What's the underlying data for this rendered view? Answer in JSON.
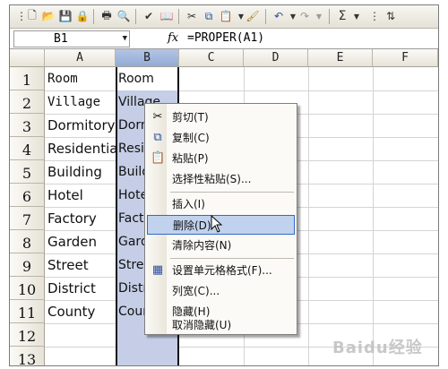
{
  "formula_bar": {
    "name_box": "B1",
    "fx": "fx",
    "formula": "=PROPER(A1)"
  },
  "columns": [
    "A",
    "B",
    "C",
    "D",
    "E",
    "F"
  ],
  "rows": [
    "1",
    "2",
    "3",
    "4",
    "5",
    "6",
    "7",
    "8",
    "9",
    "10",
    "11",
    "12",
    "13"
  ],
  "column_a": [
    "Room",
    "Village",
    "Dormitory",
    "Residential",
    "Building",
    "Hotel",
    "Factory",
    "Garden",
    "Street",
    "District",
    "County"
  ],
  "column_b": [
    "Room",
    "Village",
    "Dorm",
    "Resi",
    "Build",
    "Hote",
    "Fact",
    "Gard",
    "Stree",
    "Distr",
    "Coun"
  ],
  "context_menu": {
    "items": [
      {
        "label": "剪切(T)",
        "icon": "scissors-icon"
      },
      {
        "label": "复制(C)",
        "icon": "copy-icon"
      },
      {
        "label": "粘贴(P)",
        "icon": "paste-icon"
      },
      {
        "label": "选择性粘贴(S)..."
      },
      {
        "label": "插入(I)"
      },
      {
        "label": "删除(D)",
        "highlighted": true
      },
      {
        "label": "清除内容(N)"
      },
      {
        "label": "设置单元格格式(F)...",
        "icon": "format-cells-icon"
      },
      {
        "label": "列宽(C)..."
      },
      {
        "label": "隐藏(H)"
      },
      {
        "label": "取消隐藏(U)"
      }
    ]
  },
  "watermark": "Baidu经验",
  "colors": {
    "selection": "#c5cee6",
    "menu_highlight": "#c1d2ee",
    "menu_highlight_border": "#316ac5"
  }
}
